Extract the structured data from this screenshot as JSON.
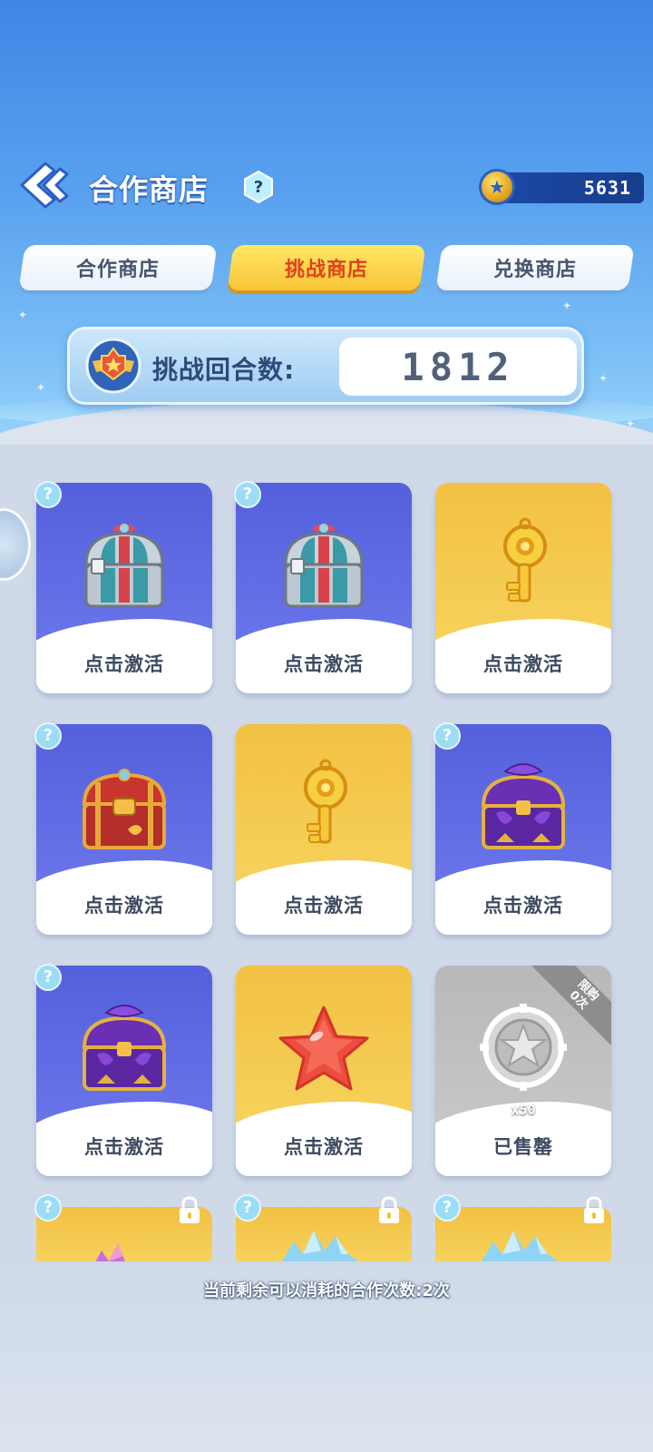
{
  "header": {
    "title": "合作商店",
    "help_icon": "?",
    "currency_value": "5631"
  },
  "tabs": [
    {
      "label": "合作商店",
      "active": false
    },
    {
      "label": "挑战商店",
      "active": true
    },
    {
      "label": "兑换商店",
      "active": false
    }
  ],
  "rounds": {
    "label": "挑战回合数:",
    "value": "1812"
  },
  "items": [
    {
      "label": "点击激活",
      "theme": "purple",
      "icon": "silver-chest-icon",
      "help": "?"
    },
    {
      "label": "点击激活",
      "theme": "purple",
      "icon": "silver-chest-icon",
      "help": "?"
    },
    {
      "label": "点击激活",
      "theme": "yellow",
      "icon": "golden-key-icon"
    },
    {
      "label": "点击激活",
      "theme": "purple",
      "icon": "red-chest-icon",
      "help": "?"
    },
    {
      "label": "点击激活",
      "theme": "yellow",
      "icon": "golden-key-icon"
    },
    {
      "label": "点击激活",
      "theme": "purple",
      "icon": "purple-chest-icon",
      "help": "?"
    },
    {
      "label": "点击激活",
      "theme": "purple",
      "icon": "purple-chest-icon",
      "help": "?"
    },
    {
      "label": "点击激活",
      "theme": "yellow",
      "icon": "red-star-icon"
    },
    {
      "label": "已售罄",
      "theme": "grey",
      "icon": "silver-star-coin-icon",
      "ribbon": "限购\n0次",
      "quantity": "x50"
    }
  ],
  "locked_items": [
    {
      "help": "?",
      "icon": "crystal-item-icon"
    },
    {
      "help": "?",
      "icon": "crystal-item-icon"
    },
    {
      "help": "?",
      "icon": "crystal-item-icon"
    }
  ],
  "footer": {
    "remaining_text": "当前剩余可以消耗的合作次数:2次"
  }
}
